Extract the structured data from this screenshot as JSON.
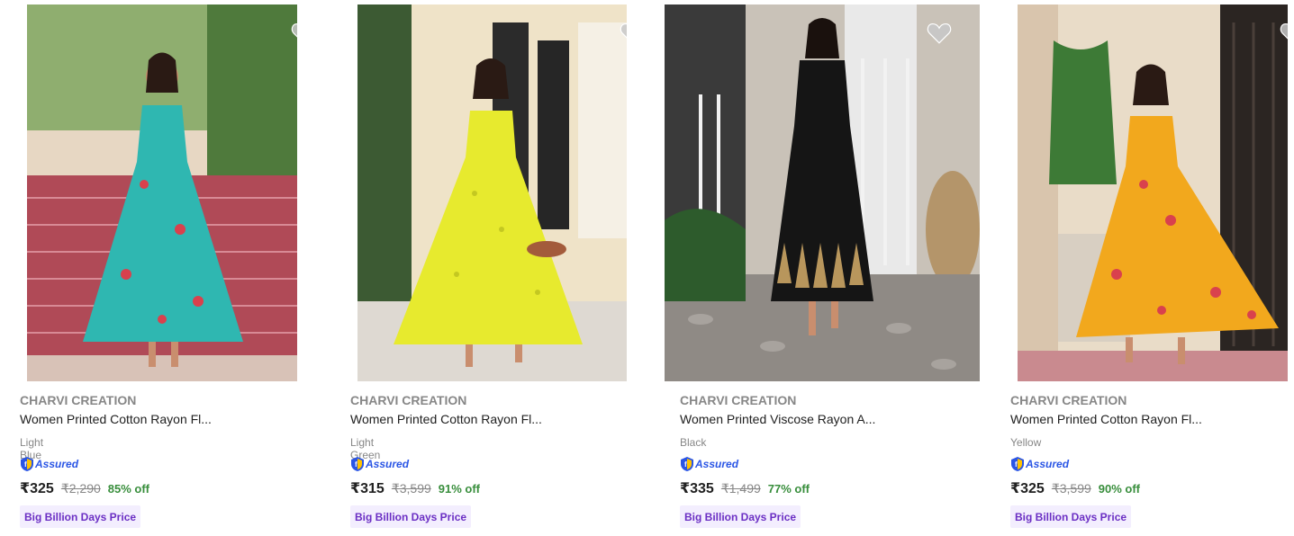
{
  "products": [
    {
      "brand": "CHARVI CREATION",
      "title": "Women Printed Cotton Rayon Fl...",
      "color": "Light Blue",
      "assured_label": "Assured",
      "price": "₹325",
      "mrp": "₹2,290",
      "discount": "85% off",
      "deal_label": "Big Billion Days Price",
      "image_icon": "product-photo-icon",
      "dress_color": "#2fb7b1"
    },
    {
      "brand": "CHARVI CREATION",
      "title": "Women Printed Cotton Rayon Fl...",
      "color": "Light Green",
      "assured_label": "Assured",
      "price": "₹315",
      "mrp": "₹3,599",
      "discount": "91% off",
      "deal_label": "Big Billion Days Price",
      "image_icon": "product-photo-icon",
      "dress_color": "#e7ea2e"
    },
    {
      "brand": "CHARVI CREATION",
      "title": "Women Printed Viscose Rayon A...",
      "color": "Black",
      "assured_label": "Assured",
      "price": "₹335",
      "mrp": "₹1,499",
      "discount": "77% off",
      "deal_label": "Big Billion Days Price",
      "image_icon": "product-photo-icon",
      "dress_color": "#151515"
    },
    {
      "brand": "CHARVI CREATION",
      "title": "Women Printed Cotton Rayon Fl...",
      "color": "Yellow",
      "assured_label": "Assured",
      "price": "₹325",
      "mrp": "₹3,599",
      "discount": "90% off",
      "deal_label": "Big Billion Days Price",
      "image_icon": "product-photo-icon",
      "dress_color": "#f2a81d"
    }
  ],
  "colors": {
    "brand_text": "#878787",
    "title_text": "#212121",
    "discount_green": "#388e3c",
    "assured_blue": "#2a55e5",
    "deal_bg": "#f3eefe",
    "deal_text": "#6b2fc4"
  }
}
